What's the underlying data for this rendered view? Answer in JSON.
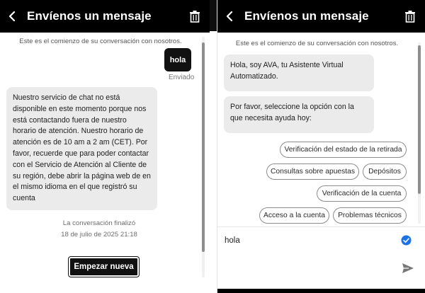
{
  "left_panel": {
    "header": {
      "title": "Envíenos un mensaje"
    },
    "intro": "Este es el comienzo de su conversación con nosotros.",
    "user_message": {
      "text": "hola",
      "status": "Enviado"
    },
    "bot_message": "Nuestro servicio de chat no está disponible en este momento porque nos está contactando fuera de nuestro horario de atención. Nuestro horario de atención es de 10 am a 2 am (CET). Por favor, recuerde que para poder contactar con el Servicio de Atención al Cliente de su región, debe abrir la página web de en el mismo idioma en el que registró su cuenta",
    "ended_label": "La conversación finalizó",
    "ended_time": "18 de julio de 2025 21:18",
    "restart_label": "Empezar nueva"
  },
  "right_panel": {
    "header": {
      "title": "Envíenos un mensaje"
    },
    "intro": "Este es el comienzo de su conversación con nosotros.",
    "bot_messages": [
      "Hola, soy AVA, tu Asistente Virtual Automatizado.",
      "Por favor, seleccione la opción con la que necesita ayuda hoy:"
    ],
    "options": [
      "Verificación del estado de la retirada",
      "Consultas sobre apuestas",
      "Depósitos",
      "Verificación de la cuenta",
      "Acceso a la cuenta",
      "Problemas técnicos"
    ],
    "input_value": "hola"
  },
  "icons": {
    "back": "chevron-left-icon",
    "trash": "trash-icon",
    "check": "check-circle-icon",
    "send": "send-icon"
  },
  "colors": {
    "header_bg": "#000000",
    "bot_bubble": "#ebebeb",
    "user_bubble": "#111111",
    "check_blue": "#1a73e8"
  }
}
